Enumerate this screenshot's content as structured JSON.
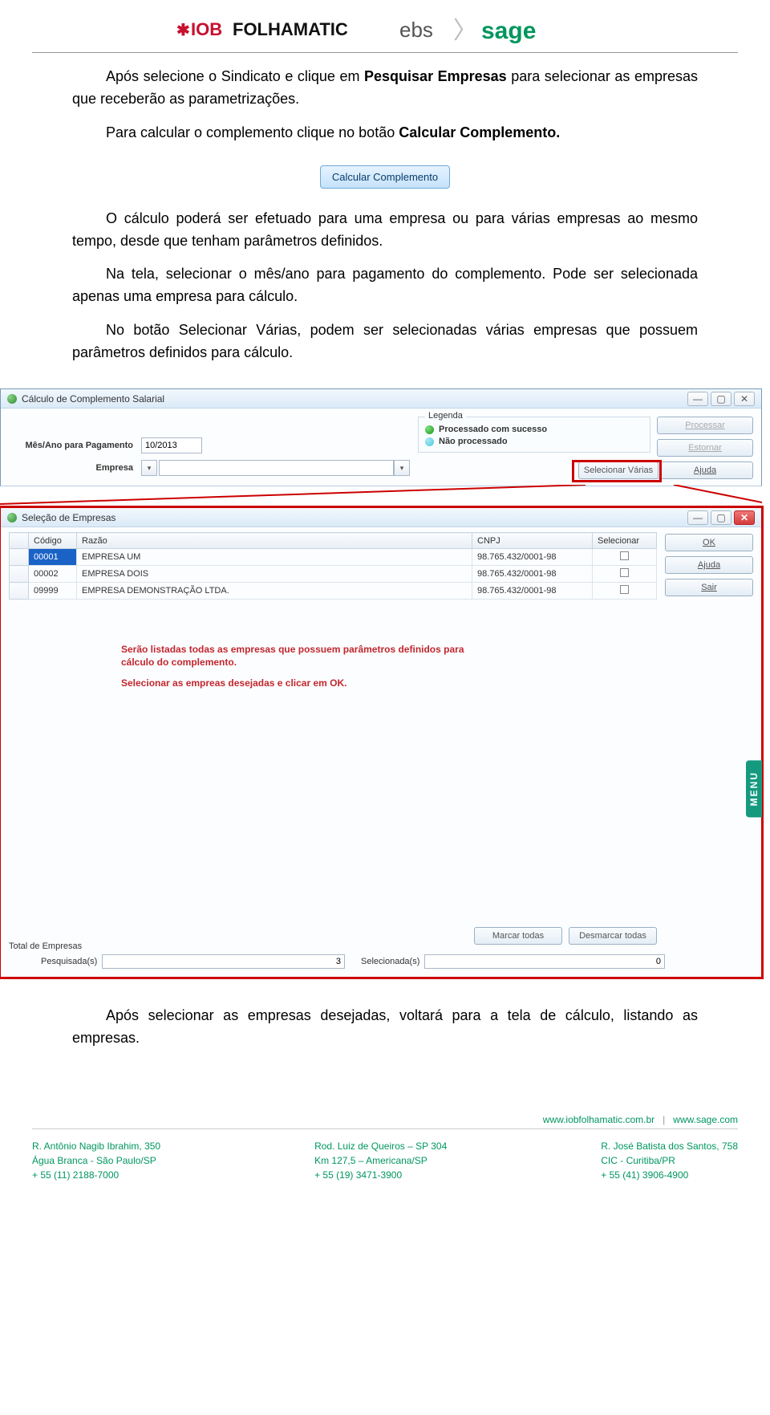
{
  "header": {
    "logo_iob": "IOB FOLHAMATIC",
    "logo_ebs": "ebs",
    "logo_sage": "sage"
  },
  "body": {
    "p1a": "Após selecione o Sindicato e clique em ",
    "p1b": "Pesquisar Empresas",
    "p1c": " para selecionar as empresas que receberão as parametrizações.",
    "p2a": "Para calcular o complemento clique no botão ",
    "p2b": "Calcular Complemento.",
    "btn_calc": "Calcular Complemento",
    "p3": "O cálculo poderá ser efetuado para uma empresa ou para várias empresas ao mesmo tempo, desde que tenham parâmetros definidos.",
    "p4": "Na tela, selecionar o mês/ano para pagamento do complemento. Pode ser selecionada apenas uma empresa para cálculo.",
    "p5": "No botão Selecionar Várias, podem ser selecionadas várias empresas que possuem parâmetros definidos para cálculo.",
    "p6": "Após selecionar as empresas desejadas, voltará para a tela de cálculo, listando as empresas."
  },
  "win1": {
    "title": "Cálculo de Complemento Salarial",
    "lbl_mesano": "Mês/Ano para Pagamento",
    "val_mesano": "10/2013",
    "lbl_empresa": "Empresa",
    "legenda_title": "Legenda",
    "leg_ok": "Processado com sucesso",
    "leg_np": "Não processado",
    "btn_processar": "Processar",
    "btn_estornar": "Estornar",
    "btn_ajuda": "Ajuda",
    "btn_selvarias": "Selecionar Várias"
  },
  "win2": {
    "title": "Seleção de Empresas",
    "cols": {
      "codigo": "Código",
      "razao": "Razão",
      "cnpj": "CNPJ",
      "selecionar": "Selecionar"
    },
    "rows": [
      {
        "codigo": "00001",
        "razao": "EMPRESA UM",
        "cnpj": "98.765.432/0001-98"
      },
      {
        "codigo": "00002",
        "razao": "EMPRESA DOIS",
        "cnpj": "98.765.432/0001-98"
      },
      {
        "codigo": "09999",
        "razao": "EMPRESA DEMONSTRAÇÃO LTDA.",
        "cnpj": "98.765.432/0001-98"
      }
    ],
    "red1": "Serão listadas todas as empresas que possuem parâmetros definidos para cálculo do complemento.",
    "red2": "Selecionar as empreas desejadas e clicar em OK.",
    "btn_ok": "OK",
    "btn_ajuda": "Ajuda",
    "btn_sair": "Sair",
    "btn_marcar": "Marcar todas",
    "btn_desmarcar": "Desmarcar todas",
    "tot_label": "Total de Empresas",
    "pesq_label": "Pesquisada(s)",
    "pesq_val": "3",
    "sel_label": "Selecionada(s)",
    "sel_val": "0",
    "menu": "MENU"
  },
  "footer": {
    "link1": "www.iobfolhamatic.com.br",
    "sep": "|",
    "link2": "www.sage.com",
    "col1": {
      "l1": "R. Antônio Nagib Ibrahim, 350",
      "l2": "Água Branca - São Paulo/SP",
      "l3": "+ 55 (11) 2188-7000"
    },
    "col2": {
      "l1": "Rod. Luiz de Queiros – SP 304",
      "l2": "Km 127,5 – Americana/SP",
      "l3": "+ 55 (19) 3471-3900"
    },
    "col3": {
      "l1": "R. José Batista dos Santos, 758",
      "l2": "CIC - Curitiba/PR",
      "l3": "+ 55 (41) 3906-4900"
    }
  }
}
